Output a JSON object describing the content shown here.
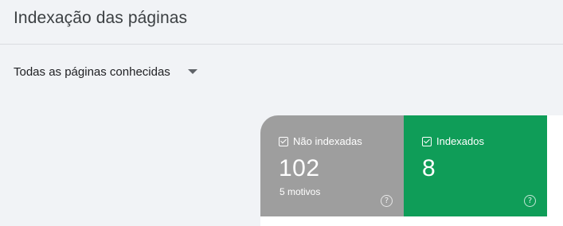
{
  "header": {
    "title": "Indexação das páginas"
  },
  "filter": {
    "selected": "Todas as páginas conhecidas",
    "icon": "arrow-drop-down-icon"
  },
  "cards": {
    "not_indexed": {
      "label": "Não indexadas",
      "value": "102",
      "subtitle": "5 motivos",
      "checked": true,
      "color": "#9e9e9e",
      "help_icon_glyph": "?"
    },
    "indexed": {
      "label": "Indexados",
      "value": "8",
      "checked": true,
      "color": "#0f9d58",
      "help_icon_glyph": "?"
    }
  },
  "colors": {
    "background": "#f1f3f6",
    "not_indexed": "#9e9e9e",
    "indexed": "#0f9d58",
    "text": "#3c4043"
  }
}
